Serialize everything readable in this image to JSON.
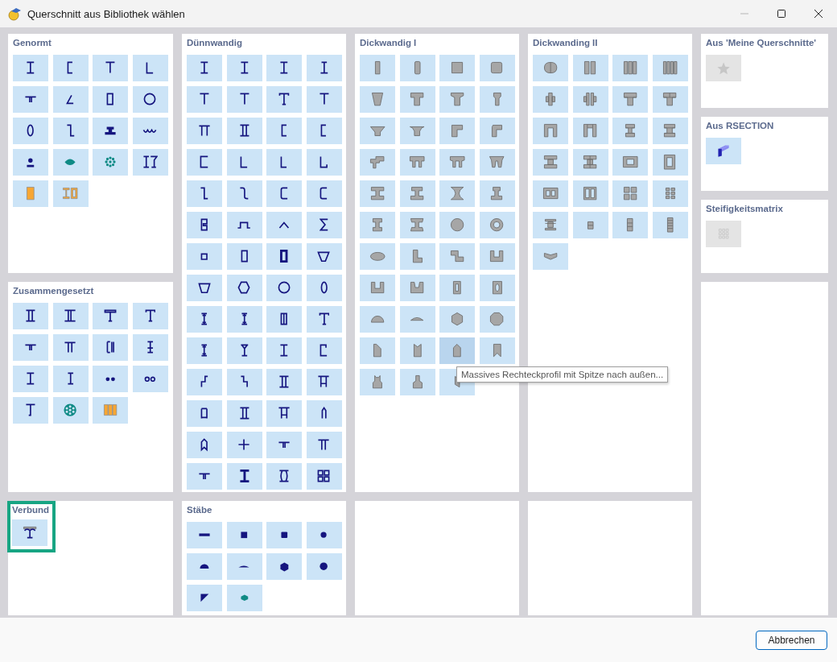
{
  "window": {
    "title": "Querschnitt aus Bibliothek wählen",
    "controls": [
      {
        "kind": "minimize",
        "disabled": true
      },
      {
        "kind": "maximize",
        "disabled": false
      },
      {
        "kind": "close",
        "disabled": false
      }
    ]
  },
  "panels": [
    {
      "kind": "group",
      "title": "Genormt",
      "selected": false,
      "tiles": [
        {
          "hovered": false
        },
        {
          "hovered": false
        },
        {
          "hovered": false
        },
        {
          "hovered": false
        },
        {
          "hovered": false
        },
        {
          "hovered": false
        },
        {
          "hovered": false
        },
        {
          "hovered": false
        },
        {
          "hovered": false
        },
        {
          "hovered": false
        },
        {
          "hovered": false
        },
        {
          "hovered": false
        },
        {
          "hovered": false
        },
        {
          "hovered": false
        },
        {
          "hovered": false
        },
        {
          "hovered": false
        },
        {
          "hovered": false
        },
        {
          "hovered": false
        }
      ]
    },
    {
      "kind": "group",
      "title": "Dünnwandig",
      "selected": false,
      "tiles": [
        {
          "hovered": false
        },
        {
          "hovered": false
        },
        {
          "hovered": false
        },
        {
          "hovered": false
        },
        {
          "hovered": false
        },
        {
          "hovered": false
        },
        {
          "hovered": false
        },
        {
          "hovered": false
        },
        {
          "hovered": false
        },
        {
          "hovered": false
        },
        {
          "hovered": false
        },
        {
          "hovered": false
        },
        {
          "hovered": false
        },
        {
          "hovered": false
        },
        {
          "hovered": false
        },
        {
          "hovered": false
        },
        {
          "hovered": false
        },
        {
          "hovered": false
        },
        {
          "hovered": false
        },
        {
          "hovered": false
        },
        {
          "hovered": false
        },
        {
          "hovered": false
        },
        {
          "hovered": false
        },
        {
          "hovered": false
        },
        {
          "hovered": false
        },
        {
          "hovered": false
        },
        {
          "hovered": false
        },
        {
          "hovered": false
        },
        {
          "hovered": false
        },
        {
          "hovered": false
        },
        {
          "hovered": false
        },
        {
          "hovered": false
        },
        {
          "hovered": false
        },
        {
          "hovered": false
        },
        {
          "hovered": false
        },
        {
          "hovered": false
        },
        {
          "hovered": false
        },
        {
          "hovered": false
        },
        {
          "hovered": false
        },
        {
          "hovered": false
        },
        {
          "hovered": false
        },
        {
          "hovered": false
        },
        {
          "hovered": false
        },
        {
          "hovered": false
        },
        {
          "hovered": false
        },
        {
          "hovered": false
        },
        {
          "hovered": false
        },
        {
          "hovered": false
        },
        {
          "hovered": false
        },
        {
          "hovered": false
        },
        {
          "hovered": false
        },
        {
          "hovered": false
        },
        {
          "hovered": false
        },
        {
          "hovered": false
        },
        {
          "hovered": false
        },
        {
          "hovered": false
        }
      ]
    },
    {
      "kind": "group",
      "title": "Dickwandig I",
      "selected": false,
      "tiles": [
        {
          "hovered": false
        },
        {
          "hovered": false
        },
        {
          "hovered": false
        },
        {
          "hovered": false
        },
        {
          "hovered": false
        },
        {
          "hovered": false
        },
        {
          "hovered": false
        },
        {
          "hovered": false
        },
        {
          "hovered": false
        },
        {
          "hovered": false
        },
        {
          "hovered": false
        },
        {
          "hovered": false
        },
        {
          "hovered": false
        },
        {
          "hovered": false
        },
        {
          "hovered": false
        },
        {
          "hovered": false
        },
        {
          "hovered": false
        },
        {
          "hovered": false
        },
        {
          "hovered": false
        },
        {
          "hovered": false
        },
        {
          "hovered": false
        },
        {
          "hovered": false
        },
        {
          "hovered": false
        },
        {
          "hovered": false
        },
        {
          "hovered": false
        },
        {
          "hovered": false
        },
        {
          "hovered": false
        },
        {
          "hovered": false
        },
        {
          "hovered": false
        },
        {
          "hovered": false
        },
        {
          "hovered": false
        },
        {
          "hovered": false
        },
        {
          "hovered": false
        },
        {
          "hovered": false
        },
        {
          "hovered": false
        },
        {
          "hovered": false
        },
        {
          "hovered": false
        },
        {
          "hovered": false
        },
        {
          "hovered": true
        },
        {
          "hovered": false
        },
        {
          "hovered": false
        },
        {
          "hovered": false
        },
        {
          "hovered": false
        }
      ]
    },
    {
      "kind": "group",
      "title": "Dickwanding II",
      "selected": false,
      "tiles": [
        {
          "hovered": false
        },
        {
          "hovered": false
        },
        {
          "hovered": false
        },
        {
          "hovered": false
        },
        {
          "hovered": false
        },
        {
          "hovered": false
        },
        {
          "hovered": false
        },
        {
          "hovered": false
        },
        {
          "hovered": false
        },
        {
          "hovered": false
        },
        {
          "hovered": false
        },
        {
          "hovered": false
        },
        {
          "hovered": false
        },
        {
          "hovered": false
        },
        {
          "hovered": false
        },
        {
          "hovered": false
        },
        {
          "hovered": false
        },
        {
          "hovered": false
        },
        {
          "hovered": false
        },
        {
          "hovered": false
        },
        {
          "hovered": false
        },
        {
          "hovered": false
        },
        {
          "hovered": false
        },
        {
          "hovered": false
        },
        {
          "hovered": false
        }
      ]
    },
    {
      "kind": "group",
      "title": "Aus 'Meine Querschnitte'",
      "selected": false,
      "tiles": [
        {
          "hovered": false,
          "disabled": true
        }
      ]
    },
    {
      "kind": "group",
      "title": "Aus RSECTION",
      "selected": false,
      "tiles": [
        {
          "hovered": false,
          "disabled": false
        }
      ]
    },
    {
      "kind": "group",
      "title": "Steifigkeitsmatrix",
      "selected": false,
      "tiles": [
        {
          "hovered": false,
          "disabled": true
        }
      ]
    },
    {
      "kind": "group",
      "title": "Zusammengesetzt",
      "selected": false,
      "tiles": [
        {
          "hovered": false
        },
        {
          "hovered": false
        },
        {
          "hovered": false
        },
        {
          "hovered": false
        },
        {
          "hovered": false
        },
        {
          "hovered": false
        },
        {
          "hovered": false
        },
        {
          "hovered": false
        },
        {
          "hovered": false
        },
        {
          "hovered": false
        },
        {
          "hovered": false
        },
        {
          "hovered": false
        },
        {
          "hovered": false
        },
        {
          "hovered": false
        },
        {
          "hovered": false
        }
      ]
    },
    {
      "kind": "empty"
    },
    {
      "kind": "group",
      "title": "Verbund",
      "selected": true,
      "tiles": [
        {
          "hovered": false
        }
      ]
    },
    {
      "kind": "group",
      "title": "Stäbe",
      "selected": false,
      "tiles": [
        {
          "hovered": false
        },
        {
          "hovered": false
        },
        {
          "hovered": false
        },
        {
          "hovered": false
        },
        {
          "hovered": false
        },
        {
          "hovered": false
        },
        {
          "hovered": false
        },
        {
          "hovered": false
        },
        {
          "hovered": false
        },
        {
          "hovered": false
        }
      ]
    },
    {
      "kind": "empty"
    },
    {
      "kind": "empty"
    }
  ],
  "tooltip": {
    "text": "Massives Rechteckprofil mit Spitze nach außen..."
  },
  "buttons": [
    "Abbrechen"
  ]
}
